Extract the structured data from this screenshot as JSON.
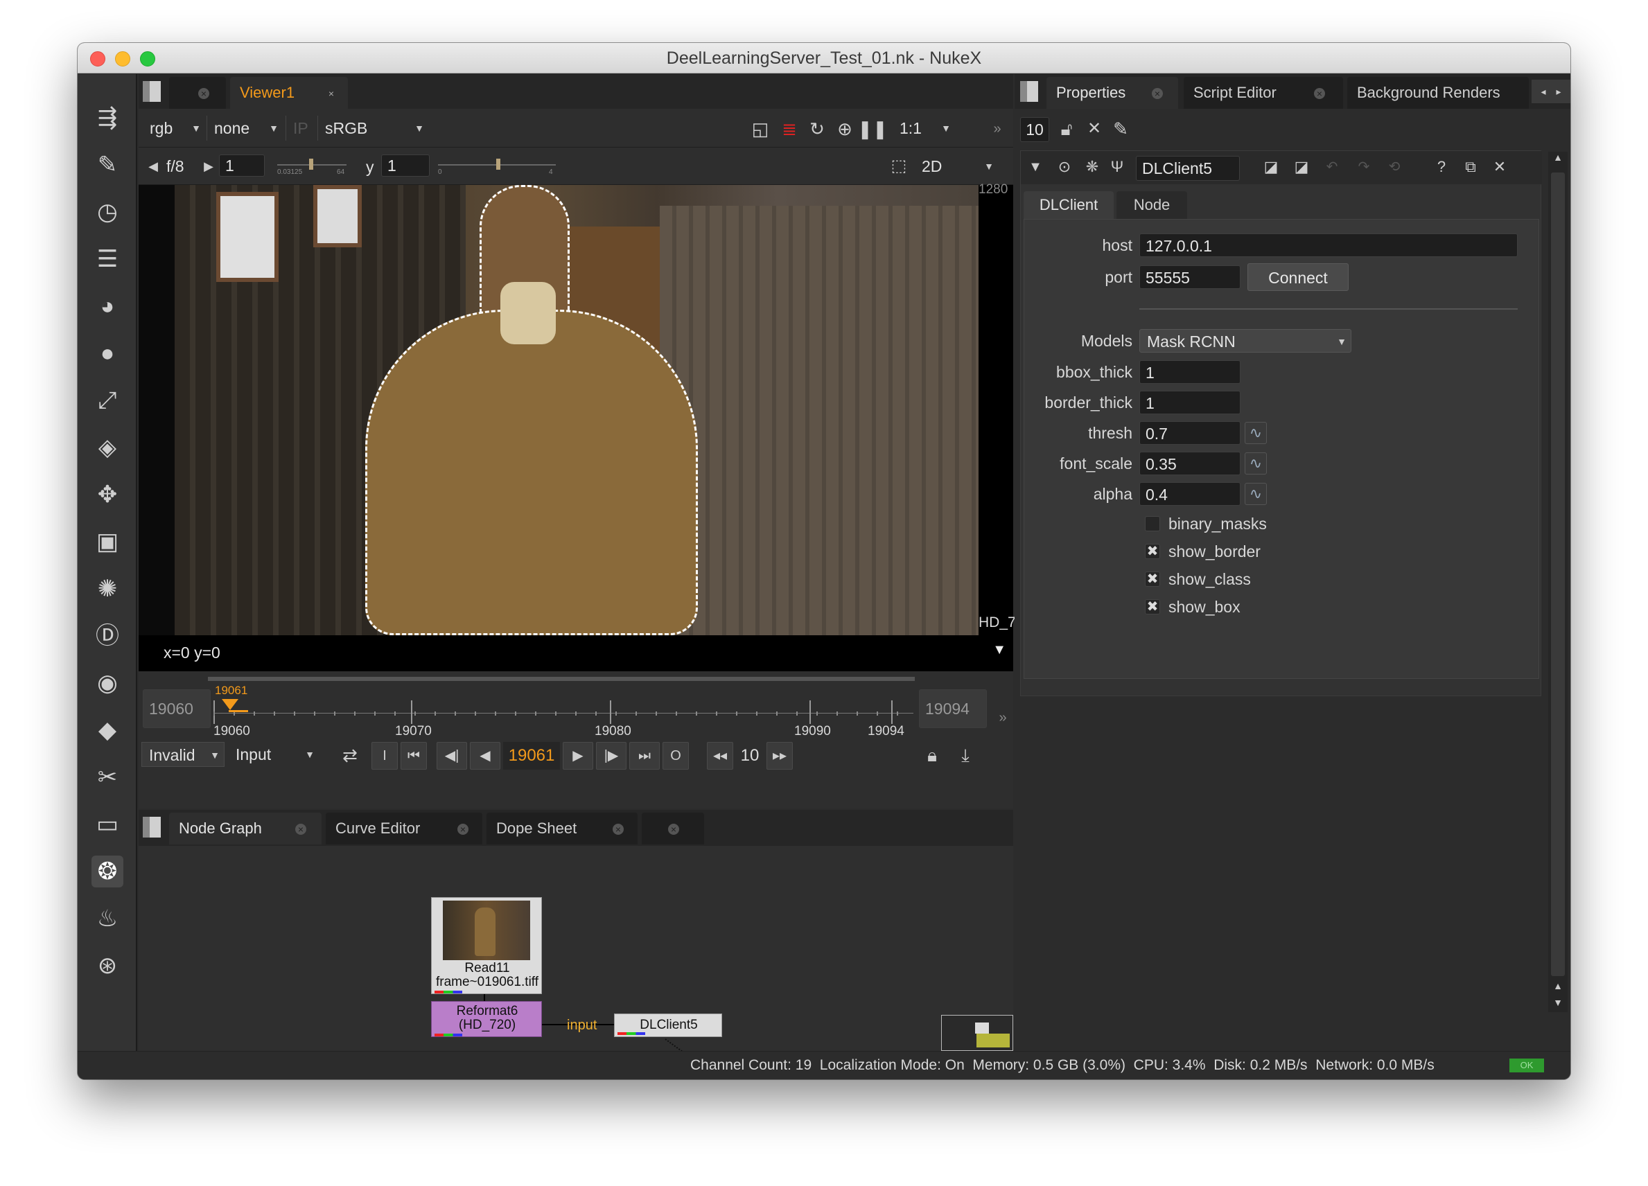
{
  "window": {
    "title": "DeelLearningServer_Test_01.nk - NukeX"
  },
  "left_toolbar": {
    "icons": [
      "toolsets-icon",
      "paint-icon",
      "time-icon",
      "channel-icon",
      "color-icon",
      "filter-icon",
      "keyer-icon",
      "merge-icon",
      "transform-icon",
      "3d-icon",
      "particles-icon",
      "deep-icon",
      "views-icon",
      "metadata-icon",
      "toolsets-wrench-icon",
      "other-icon",
      "furnace-icon",
      "smart-icon",
      "custom-icon"
    ]
  },
  "viewer": {
    "tab_label": "Viewer1",
    "channels": "rgb",
    "alpha_channel": "none",
    "ip_label": "IP",
    "lut": "sRGB",
    "zoom": "1:1",
    "fstop": "f/8",
    "gain": "1",
    "gamma_label": "y",
    "gamma": "1",
    "slider_ticks": [
      "0.03125",
      "1",
      "64"
    ],
    "gamma_ticks": [
      "0",
      "1",
      "4"
    ],
    "view_mode": "2D",
    "format_label": "HD_7",
    "top_label": "1280",
    "coords": "x=0 y=0"
  },
  "timeline": {
    "start": "19060",
    "end": "19094",
    "current_marker": "19061",
    "tick_labels": [
      "19060",
      "19070",
      "19080",
      "19090",
      "19094"
    ],
    "cache_mode": "Invalid",
    "playback_mode": "Input",
    "current_frame": "19061",
    "in_label": "I",
    "out_label": "O",
    "increment": "10"
  },
  "bottom_panel": {
    "tabs": [
      "Node Graph",
      "Curve Editor",
      "Dope Sheet"
    ]
  },
  "node_graph": {
    "read_node": {
      "name": "Read11",
      "file": "frame~019061.tiff"
    },
    "reformat_node": {
      "name": "Reformat6",
      "format": "(HD_720)"
    },
    "dlclient_node": {
      "name": "DLClient5"
    },
    "edge_label": "input"
  },
  "properties": {
    "tabs": [
      "Properties",
      "Script Editor",
      "Background Renders"
    ],
    "max_panels": "10",
    "node_name": "DLClient5",
    "subtabs": [
      "DLClient",
      "Node"
    ],
    "host_label": "host",
    "host": "127.0.0.1",
    "port_label": "port",
    "port": "55555",
    "connect_label": "Connect",
    "models_label": "Models",
    "model": "Mask RCNN",
    "bbox_thick_label": "bbox_thick",
    "bbox_thick": "1",
    "border_thick_label": "border_thick",
    "border_thick": "1",
    "thresh_label": "thresh",
    "thresh": "0.7",
    "font_scale_label": "font_scale",
    "font_scale": "0.35",
    "alpha_label": "alpha",
    "alpha": "0.4",
    "checkboxes": [
      {
        "label": "binary_masks",
        "checked": false
      },
      {
        "label": "show_border",
        "checked": true
      },
      {
        "label": "show_class",
        "checked": true
      },
      {
        "label": "show_box",
        "checked": true
      }
    ]
  },
  "status_bar": {
    "text": "Channel Count: 19  Localization Mode: On  Memory: 0.5 GB (3.0%)  CPU: 3.4%  Disk: 0.2 MB/s  Network: 0.0 MB/s",
    "indicator": "OK",
    "indicator_color": "#2e9a2e"
  }
}
